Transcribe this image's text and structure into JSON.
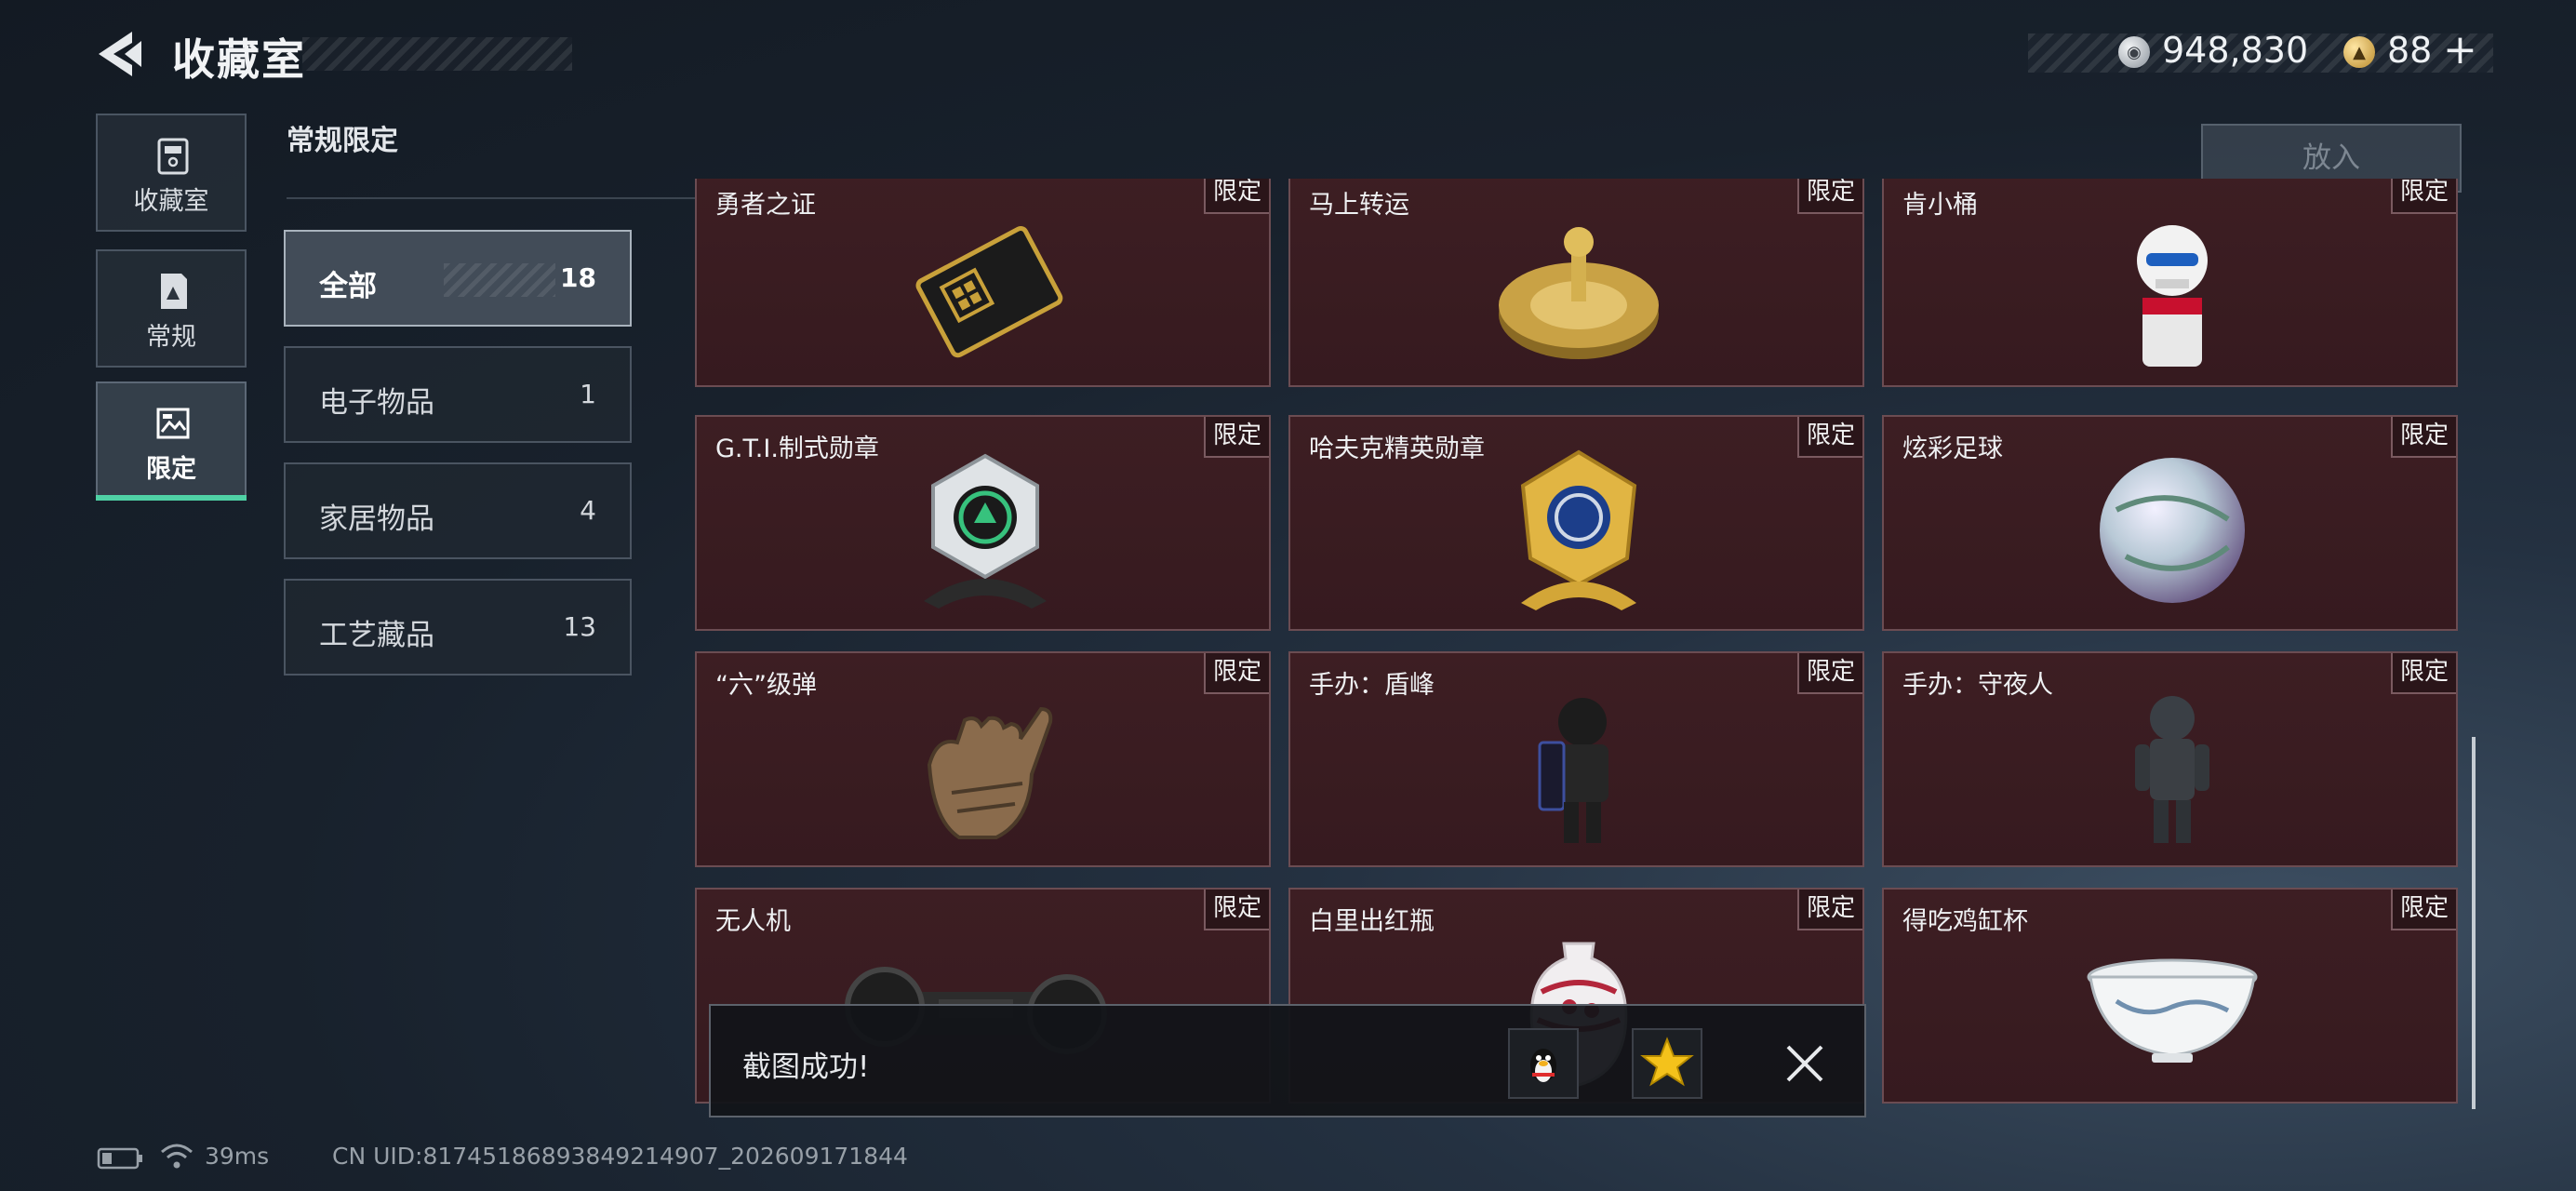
{
  "header": {
    "title": "收藏室"
  },
  "currency": {
    "coins": "948,830",
    "tokens": "88",
    "plus": "+"
  },
  "nav": [
    {
      "label": "收藏室",
      "icon": "trash-bin-icon"
    },
    {
      "label": "常规",
      "icon": "document-icon"
    },
    {
      "label": "限定",
      "icon": "image-icon"
    }
  ],
  "section": {
    "title": "常规限定"
  },
  "categories": [
    {
      "label": "全部",
      "count": "18"
    },
    {
      "label": "电子物品",
      "count": "1"
    },
    {
      "label": "家居物品",
      "count": "4"
    },
    {
      "label": "工艺藏品",
      "count": "13"
    }
  ],
  "put_in_label": "放入",
  "items": [
    {
      "name": "勇者之证",
      "tag": "限定"
    },
    {
      "name": "马上转运",
      "tag": "限定"
    },
    {
      "name": "肯小桶",
      "tag": "限定"
    },
    {
      "name": "G.T.I.制式勋章",
      "tag": "限定"
    },
    {
      "name": "哈夫克精英勋章",
      "tag": "限定"
    },
    {
      "name": "炫彩足球",
      "tag": "限定"
    },
    {
      "name": "“六”级弹",
      "tag": "限定"
    },
    {
      "name": "手办：盾峰",
      "tag": "限定"
    },
    {
      "name": "手办：守夜人",
      "tag": "限定"
    },
    {
      "name": "无人机",
      "tag": "限定"
    },
    {
      "name": "白里出红瓶",
      "tag": "限定"
    },
    {
      "name": "得吃鸡缸杯",
      "tag": "限定"
    }
  ],
  "toast": {
    "message": "截图成功!"
  },
  "footer": {
    "ping": "39ms",
    "uid": "CN UID:81745186893849214907_202609171844"
  },
  "colors": {
    "accent": "#4fd1a5",
    "card_bg": "#3a1c21",
    "card_border": "#6b4c52"
  }
}
